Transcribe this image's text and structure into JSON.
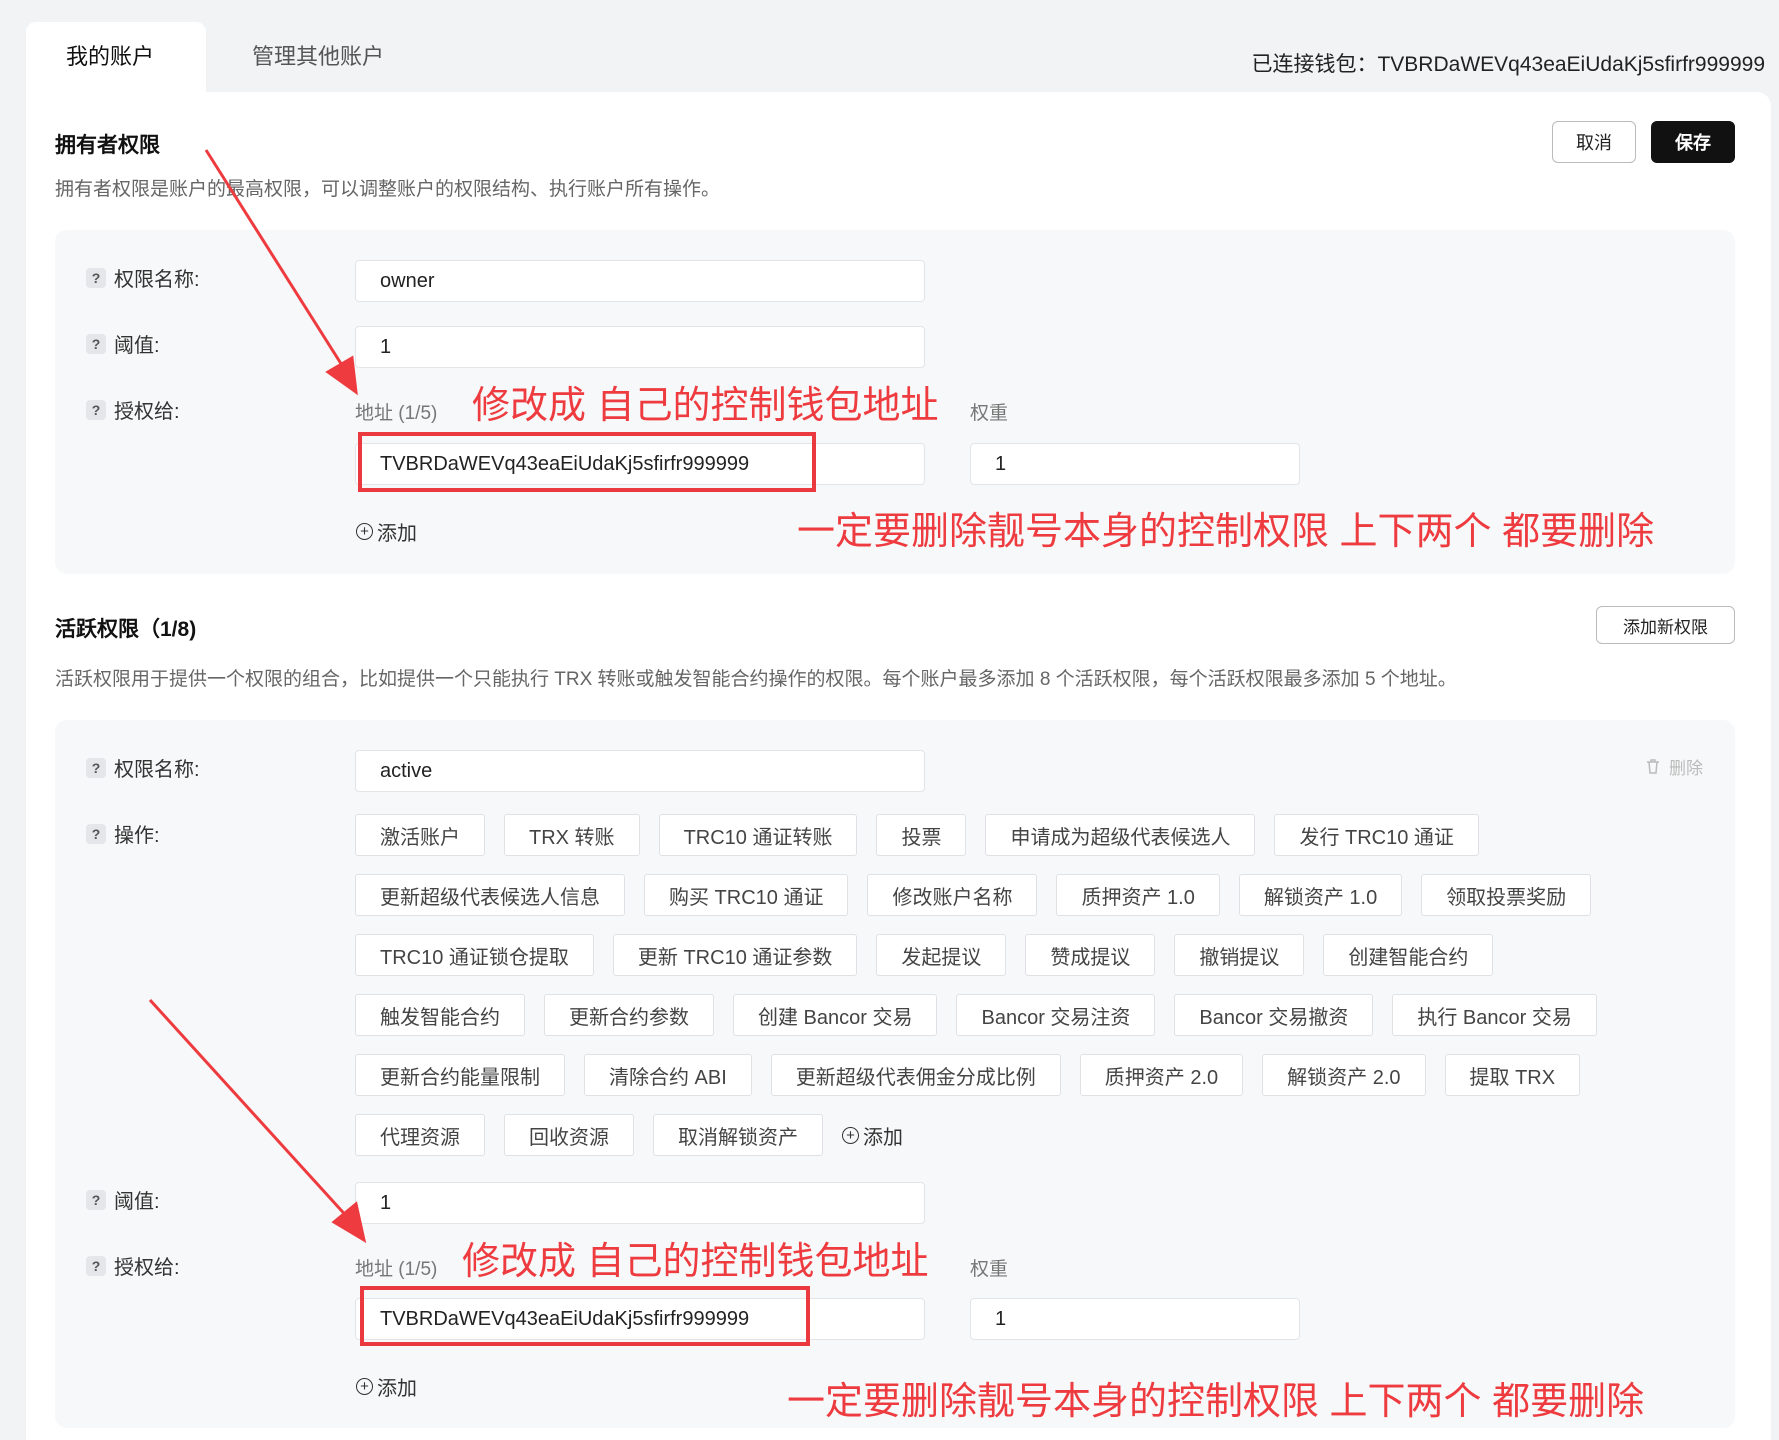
{
  "tabs": [
    {
      "label": "我的账户",
      "active": true
    },
    {
      "label": "管理其他账户",
      "active": false
    }
  ],
  "wallet": "已连接钱包：TVBRDaWEVq43eaEiUdaKj5sfirfr999999",
  "owner": {
    "title": "拥有者权限",
    "desc": "拥有者权限是账户的最高权限，可以调整账户的权限结构、执行账户所有操作。",
    "cancel": "取消",
    "save": "保存",
    "name_label": "权限名称:",
    "name_value": "owner",
    "threshold_label": "阈值:",
    "threshold_value": "1",
    "grant_label": "授权给:",
    "address_label": "地址 (1/5)",
    "weight_label": "权重",
    "address_value": "TVBRDaWEVq43eaEiUdaKj5sfirfr999999",
    "weight_value": "1",
    "add": "添加"
  },
  "active": {
    "title": "活跃权限（1/8)",
    "add_permission": "添加新权限",
    "desc": "活跃权限用于提供一个权限的组合，比如提供一个只能执行 TRX 转账或触发智能合约操作的权限。每个账户最多添加 8 个活跃权限，每个活跃权限最多添加 5 个地址。",
    "name_label": "权限名称:",
    "name_value": "active",
    "delete": "删除",
    "ops_label": "操作:",
    "ops_rows": [
      [
        "激活账户",
        "TRX 转账",
        "TRC10 通证转账",
        "投票",
        "申请成为超级代表候选人",
        "发行 TRC10 通证"
      ],
      [
        "更新超级代表候选人信息",
        "购买 TRC10 通证",
        "修改账户名称",
        "质押资产 1.0",
        "解锁资产 1.0",
        "领取投票奖励"
      ],
      [
        "TRC10 通证锁仓提取",
        "更新 TRC10 通证参数",
        "发起提议",
        "赞成提议",
        "撤销提议",
        "创建智能合约"
      ],
      [
        "触发智能合约",
        "更新合约参数",
        "创建 Bancor 交易",
        "Bancor 交易注资",
        "Bancor 交易撤资",
        "执行 Bancor 交易"
      ],
      [
        "更新合约能量限制",
        "清除合约 ABI",
        "更新超级代表佣金分成比例",
        "质押资产 2.0",
        "解锁资产 2.0",
        "提取 TRX"
      ],
      [
        "代理资源",
        "回收资源",
        "取消解锁资产"
      ]
    ],
    "ops_add": "添加",
    "threshold_label": "阈值:",
    "threshold_value": "1",
    "grant_label": "授权给:",
    "address_label": "地址 (1/5)",
    "weight_label": "权重",
    "address_value": "TVBRDaWEVq43eaEiUdaKj5sfirfr999999",
    "weight_value": "1",
    "add": "添加"
  },
  "annotations": {
    "modify_top": "修改成 自己的控制钱包地址",
    "delete_top": "一定要删除靓号本身的控制权限 上下两个  都要删除",
    "modify_bottom": "修改成 自己的控制钱包地址",
    "delete_bottom": "一定要删除靓号本身的控制权限 上下两个  都要删除",
    "color": "#ee3b3f"
  }
}
